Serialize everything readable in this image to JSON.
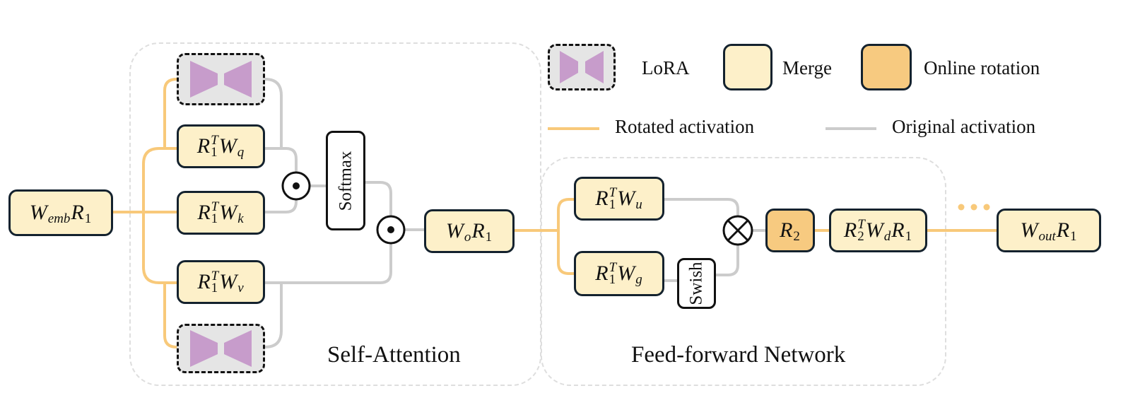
{
  "colors": {
    "merge_fill": "#fdf0c9",
    "online_rotation_fill": "#f7ca80",
    "lora_fill": "#e5e5e5",
    "lora_shape": "#c79ccb",
    "rotated_activation": "#f8c97a",
    "original_activation": "#cccccc",
    "region_border": "#dedede"
  },
  "legend": {
    "lora": "LoRA",
    "merge": "Merge",
    "online_rotation": "Online rotation",
    "rotated_activation": "Rotated activation",
    "original_activation": "Original activation"
  },
  "regions": {
    "self_attention": "Self-Attention",
    "ffn": "Feed-forward Network"
  },
  "nodes": {
    "emb": [
      {
        "b": "W",
        "sub": "emb"
      },
      {
        "b": "R",
        "sub": "1"
      }
    ],
    "q": [
      {
        "b": "R",
        "sub": "1",
        "sup": "T"
      },
      {
        "b": "W",
        "sub": "q",
        "subit": true
      }
    ],
    "k": [
      {
        "b": "R",
        "sub": "1",
        "sup": "T"
      },
      {
        "b": "W",
        "sub": "k",
        "subit": true
      }
    ],
    "v": [
      {
        "b": "R",
        "sub": "1",
        "sup": "T"
      },
      {
        "b": "W",
        "sub": "v",
        "subit": true
      }
    ],
    "o": [
      {
        "b": "W",
        "sub": "o",
        "subit": true
      },
      {
        "b": "R",
        "sub": "1"
      }
    ],
    "u": [
      {
        "b": "R",
        "sub": "1",
        "sup": "T"
      },
      {
        "b": "W",
        "sub": "u",
        "subit": true
      }
    ],
    "g": [
      {
        "b": "R",
        "sub": "1",
        "sup": "T"
      },
      {
        "b": "W",
        "sub": "g",
        "subit": true
      }
    ],
    "r2": [
      {
        "b": "R",
        "sub": "2"
      }
    ],
    "d": [
      {
        "b": "R",
        "sub": "2",
        "sup": "T"
      },
      {
        "b": "W",
        "sub": "d",
        "subit": true
      },
      {
        "b": "R",
        "sub": "1"
      }
    ],
    "out": [
      {
        "b": "W",
        "sub": "out",
        "subit": true
      },
      {
        "b": "R",
        "sub": "1"
      }
    ]
  },
  "ops": {
    "softmax": "Softmax",
    "swish": "Swish",
    "hadamard": "⊙",
    "multiply": "⊗",
    "continuation": "..."
  }
}
